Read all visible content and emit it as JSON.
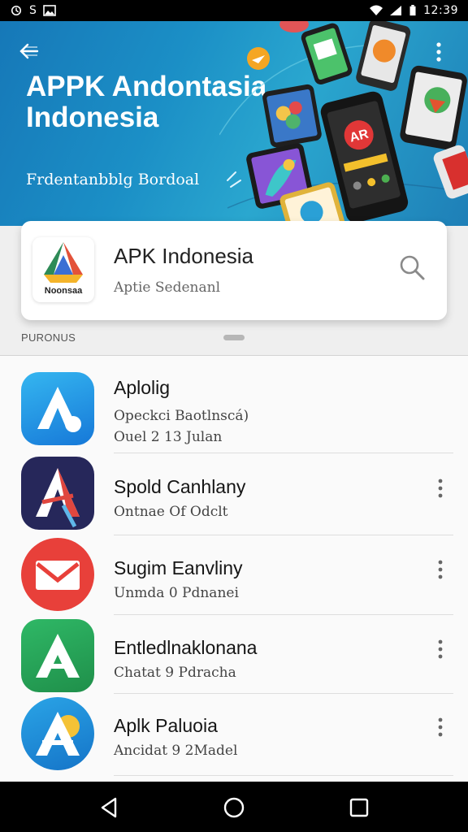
{
  "status_bar": {
    "left_icons": [
      "sync-icon",
      "s-icon",
      "image-icon"
    ],
    "left_text": "S",
    "right_icons": [
      "wifi-icon",
      "signal-icon",
      "battery-icon"
    ],
    "time": "12:39"
  },
  "hero": {
    "title": "APPK Andontasia Indonesia",
    "subtitle": "Frdentanbblg Bordoal",
    "back_icon": "arrow-left-icon",
    "more_icon": "more-vertical-icon",
    "colors": {
      "gradient_start": "#1678b8",
      "gradient_end": "#2aa7cf"
    }
  },
  "app_header": {
    "logo_text": "Noonsaa",
    "name": "APK Indonesia",
    "tagline": "Aptie Sedenanl",
    "search_icon": "search-icon"
  },
  "section": {
    "label": "PURONUS"
  },
  "list": {
    "items": [
      {
        "title": "Aplolig",
        "subtitle": "Opeckci Baotlnscá)",
        "subtitle2": "Ouel 2 13 Julan",
        "icon": "blue-a-app-icon",
        "has_more": false
      },
      {
        "title": "Spold Canhlany",
        "subtitle": "Ontnae Of Odclt",
        "icon": "navy-a-app-icon",
        "has_more": true
      },
      {
        "title": "Sugim Eanvliny",
        "subtitle": "Unmda 0 Pdnanei",
        "icon": "red-mail-app-icon",
        "has_more": true
      },
      {
        "title": "Entledlnaklonana",
        "subtitle": "Chatat 9 Pdracha",
        "icon": "green-a-app-icon",
        "has_more": true
      },
      {
        "title": "Aplk Paluoia",
        "subtitle": "Ancidat 9 2Madel",
        "icon": "blue-yellow-a-app-icon",
        "has_more": true
      }
    ]
  },
  "nav_bar": {
    "back_icon": "nav-back-triangle-icon",
    "home_icon": "nav-home-circle-icon",
    "recents_icon": "nav-recents-square-icon"
  }
}
